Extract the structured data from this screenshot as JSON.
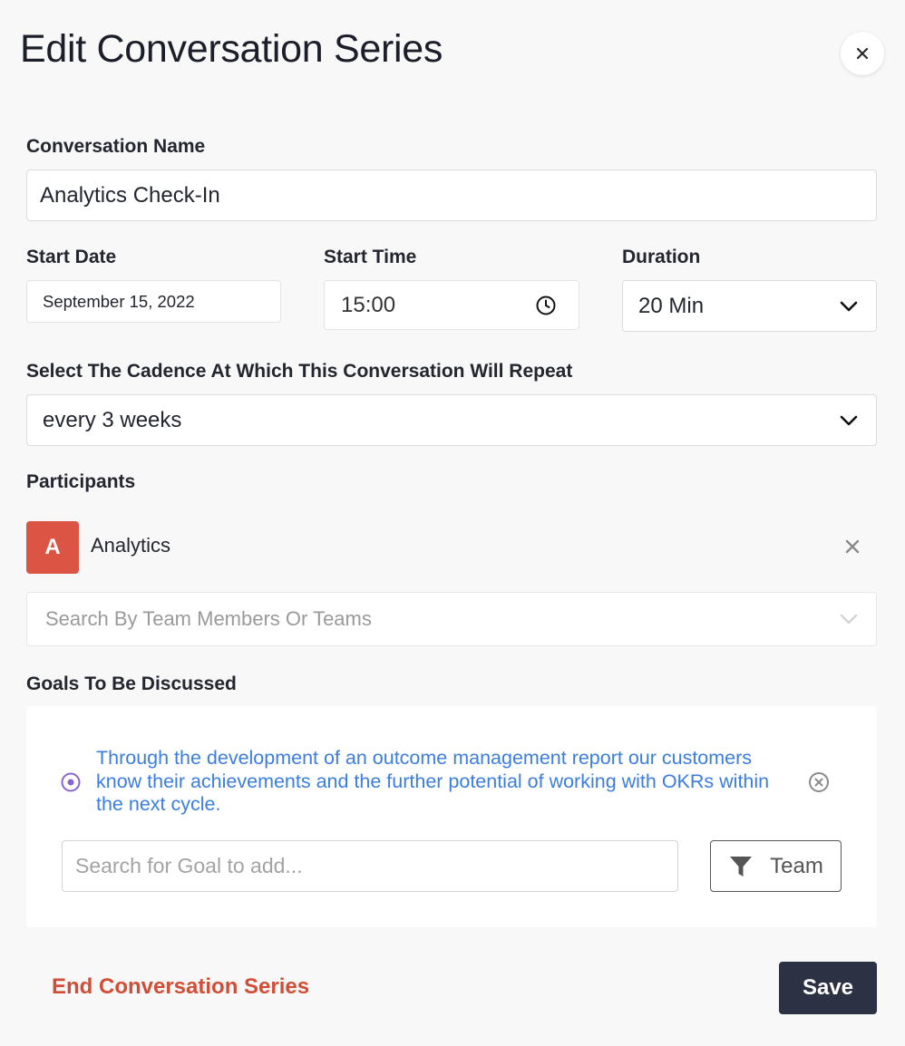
{
  "dialog": {
    "title": "Edit Conversation Series",
    "close_icon": "close-icon"
  },
  "form": {
    "name": {
      "label": "Conversation Name",
      "value": "Analytics Check-In"
    },
    "start_date": {
      "label": "Start Date",
      "value": "September 15, 2022"
    },
    "start_time": {
      "label": "Start Time",
      "value": "15:00",
      "icon": "clock-icon"
    },
    "duration": {
      "label": "Duration",
      "value": "20 Min",
      "icon": "chevron-down-icon"
    },
    "cadence": {
      "label": "Select The Cadence At Which This Conversation Will Repeat",
      "value": "every 3 weeks",
      "icon": "chevron-down-icon"
    }
  },
  "participants": {
    "label": "Participants",
    "items": [
      {
        "initial": "A",
        "name": "Analytics",
        "avatar_color": "#dc5443"
      }
    ],
    "search_placeholder": "Search By Team Members Or Teams"
  },
  "goals": {
    "label": "Goals To Be Discussed",
    "items": [
      {
        "text": "Through the development of an outcome management report our customers know their achievements and the further potential of working with OKRs within the next cycle."
      }
    ],
    "search_placeholder": "Search for Goal to add...",
    "filter_button": {
      "label": "Team",
      "icon": "filter-icon"
    }
  },
  "footer": {
    "end_label": "End Conversation Series",
    "save_label": "Save"
  },
  "colors": {
    "accent_link": "#3b7de0",
    "danger": "#d14e36",
    "primary_button": "#2c3143",
    "radio": "#8a63d2"
  }
}
